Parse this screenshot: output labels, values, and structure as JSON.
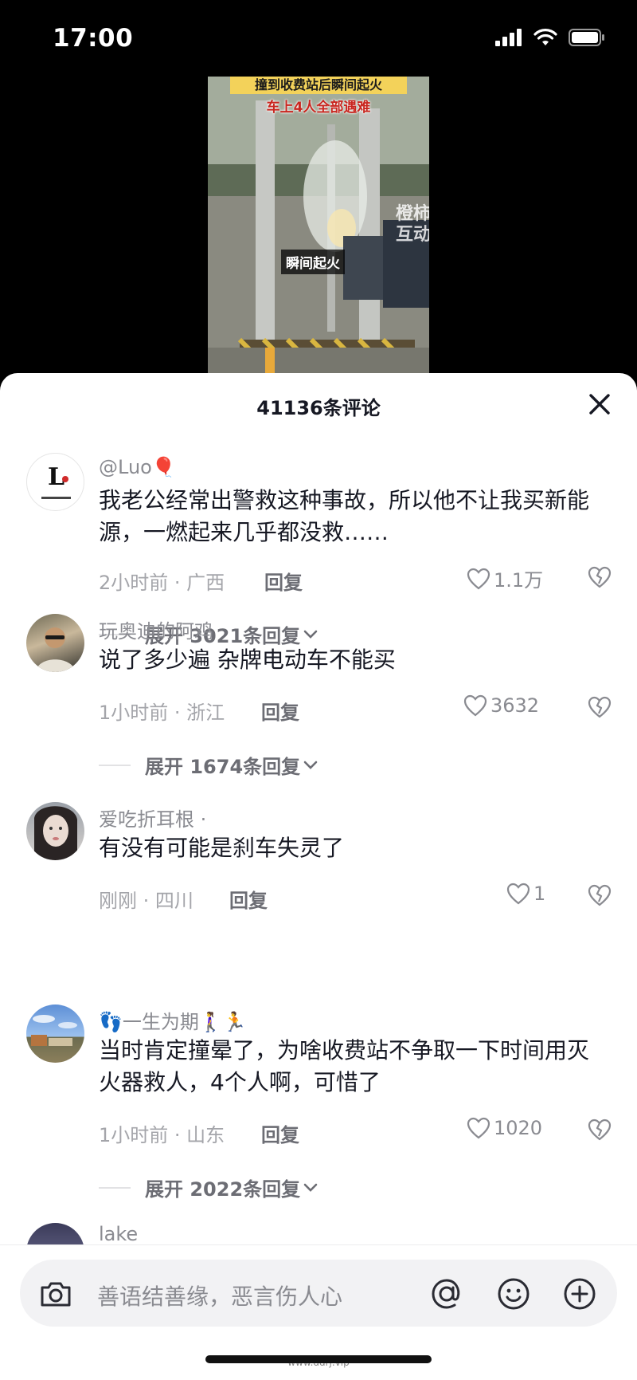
{
  "status_bar": {
    "time": "17:00"
  },
  "video": {
    "banner_line1": "撞到收费站后瞬间起火",
    "banner_line2": "车上4人全部遇难",
    "caption": "瞬间起火",
    "watermark": "橙柿互动"
  },
  "sheet": {
    "title": "41136条评论",
    "comments": [
      {
        "user": "@Luo🎈",
        "text": "我老公经常出警救这种事故，所以他不让我买新能源，一燃起来几乎都没救……",
        "meta": "2小时前 · 广西",
        "reply": "回复",
        "likes": "1.1万",
        "expand": "展开 3021条回复",
        "avatar_text": "L"
      },
      {
        "user": "玩奥迪的阿鸡",
        "text": "说了多少遍 杂牌电动车不能买",
        "meta": "1小时前 · 浙江",
        "reply": "回复",
        "likes": "3632",
        "expand": "展开 1674条回复"
      },
      {
        "user": "爱吃折耳根 ·",
        "text": "有没有可能是刹车失灵了",
        "meta": "刚刚 · 四川",
        "reply": "回复",
        "likes": "1"
      },
      {
        "user": "👣一生为期🚶‍♀️🏃",
        "text": "当时肯定撞晕了，为啥收费站不争取一下时间用灭火器救人，4个人啊，可惜了",
        "meta": "1小时前 · 山东",
        "reply": "回复",
        "likes": "1020",
        "expand": "展开 2022条回复"
      },
      {
        "user": "lake"
      }
    ]
  },
  "input": {
    "placeholder": "善语结善缘，恶言伤人心",
    "site_watermark": "www.ddrj.vip"
  },
  "colors": {
    "text_primary": "#161823",
    "text_secondary": "#8a8b91",
    "background": "#ffffff"
  }
}
